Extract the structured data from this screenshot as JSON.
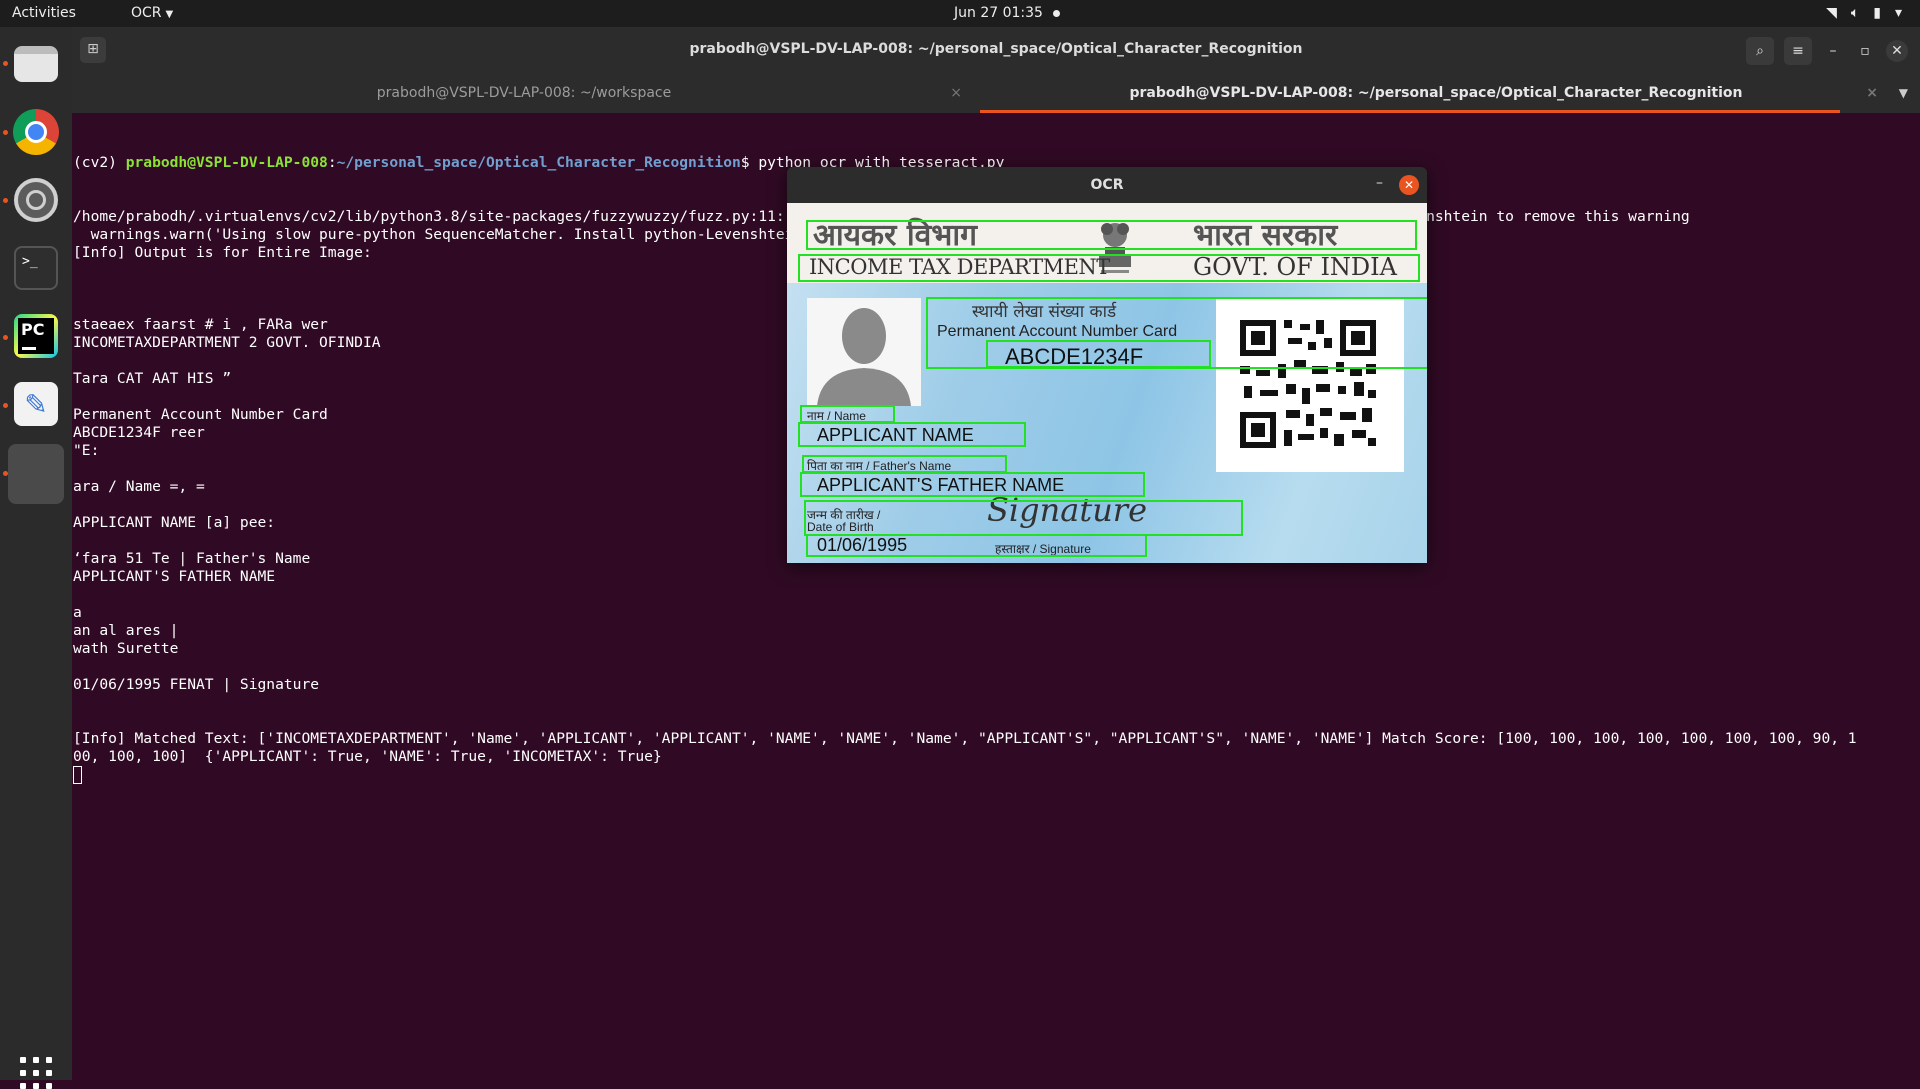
{
  "topbar": {
    "activities": "Activities",
    "app_menu": "OCR",
    "clock": "Jun 27  01:35"
  },
  "dock": {
    "items": [
      "files",
      "chrome",
      "settings",
      "terminal",
      "pycharm",
      "text-editor"
    ]
  },
  "terminal": {
    "title": "prabodh@VSPL-DV-LAP-008: ~/personal_space/Optical_Character_Recognition",
    "tabs": [
      {
        "label": "prabodh@VSPL-DV-LAP-008: ~/workspace",
        "active": false
      },
      {
        "label": "prabodh@VSPL-DV-LAP-008: ~/personal_space/Optical_Character_Recognition",
        "active": true
      }
    ],
    "prompt": {
      "env": "(cv2) ",
      "user": "prabodh@VSPL-DV-LAP-008",
      "sep": ":",
      "path": "~/personal_space/Optical_Character_Recognition",
      "dollar": "$ ",
      "command": "python ocr_with_tesseract.py"
    },
    "output": [
      "/home/prabodh/.virtualenvs/cv2/lib/python3.8/site-packages/fuzzywuzzy/fuzz.py:11: UserWarning: Using slow pure-python SequenceMatcher. Install python-Levenshtein to remove this warning",
      "  warnings.warn('Using slow pure-python SequenceMatcher. Install python-Levenshtein to remove this warning')",
      "[Info] Output is for Entire Image:",
      "",
      "",
      "",
      "staeaex faarst # i , FARa wer",
      "INCOMETAXDEPARTMENT 2 GOVT. OFINDIA",
      "",
      "Tara CAT AAT HIS ”",
      "",
      "Permanent Account Number Card",
      "ABCDE1234F reer",
      "\"E:",
      "",
      "ara / Name =, =",
      "",
      "APPLICANT NAME [a] pee:",
      "",
      "‘fara 51 Te | Father's Name",
      "APPLICANT'S FATHER NAME",
      "",
      "a",
      "an al ares |",
      "wath Surette",
      "",
      "01/06/1995 FENAT | Signature",
      "",
      "",
      "[Info] Matched Text: ['INCOMETAXDEPARTMENT', 'Name', 'APPLICANT', 'APPLICANT', 'NAME', 'NAME', 'Name', \"APPLICANT'S\", \"APPLICANT'S\", 'NAME', 'NAME'] Match Score: [100, 100, 100, 100, 100, 100, 100, 90, 1",
      "00, 100, 100]  {'APPLICANT': True, 'NAME': True, 'INCOMETAX': True}"
    ]
  },
  "ocr_window": {
    "title": "OCR",
    "card": {
      "hindi_dept": "आयकर विभाग",
      "hindi_govt": "भारत सरकार",
      "dept": "INCOME TAX DEPARTMENT",
      "govt": "GOVT. OF INDIA",
      "hindi_card": "स्थायी लेखा संख्या कार्ड",
      "card_label": "Permanent Account Number Card",
      "pan": "ABCDE1234F",
      "name_label": "नाम / Name",
      "name": "APPLICANT NAME",
      "father_label": "पिता का नाम / Father's Name",
      "father_name": "APPLICANT'S FATHER NAME",
      "dob_label_hi": "जन्म की तारीख /",
      "dob_label": "Date of Birth",
      "signature": "Signature",
      "dob": "01/06/1995",
      "sign_label": "हस्ताक्षर / Signature"
    }
  }
}
